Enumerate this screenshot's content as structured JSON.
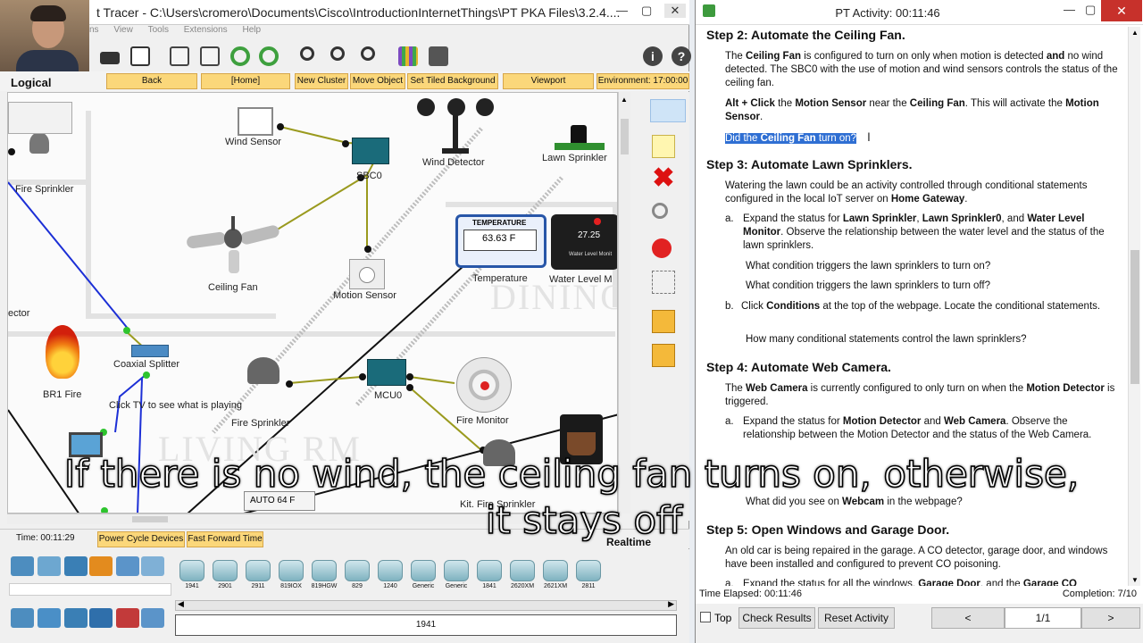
{
  "pt_window": {
    "title": "Cisco Packet Tracer - C:\\Users\\cromero\\Documents\\Cisco\\IntroductionInternetThings\\PT PKA Files\\3.2.4....",
    "title_visible": "t Tracer - C:\\Users\\cromero\\Documents\\Cisco\\IntroductionInternetThings\\PT PKA Files\\3.2.4....",
    "menu": [
      "ns",
      "View",
      "Tools",
      "Extensions",
      "Help"
    ],
    "nav": {
      "logical": "Logical",
      "back": "Back",
      "home": "[Home]",
      "new_cluster": "New Cluster",
      "move_object": "Move Object",
      "set_tiled_bg": "Set Tiled Background",
      "viewport": "Viewport",
      "environment": "Environment: 17:00:00"
    },
    "canvas_labels": {
      "wind_sensor": "Wind Sensor",
      "sbc0": "SBC0",
      "wind_detector": "Wind Detector",
      "lawn_sprinkler": "Lawn Sprinkler",
      "fire_sprinkler_left": "Fire Sprinkler",
      "ceiling_fan": "Ceiling Fan",
      "motion_sensor": "Motion Sensor",
      "temperature": "Temperature",
      "temperature_title": "TEMPERATURE",
      "temperature_value": "63.63 F",
      "water_level": "Water Level M",
      "water_level_value": "27.25",
      "water_level_inner": "Water Level Monit",
      "dining": "DINING",
      "ector": "ector",
      "br1_fire": "BR1 Fire",
      "coaxial_splitter": "Coaxial Splitter",
      "tv_hint": "Click TV to see what is playing",
      "fire_sprinkler_mid": "Fire Sprinkler",
      "mcu0": "MCU0",
      "fire_monitor": "Fire Monitor",
      "living_rm": "LIVING RM",
      "thermostat": "AUTO  64 F",
      "kit_fire_sprinkler": "Kit. Fire Sprinkler",
      "tv_label": "TV"
    },
    "bottom": {
      "time": "Time: 00:11:29",
      "power_cycle": "Power Cycle Devices",
      "fast_forward": "Fast Forward Time",
      "realtime": "Realtime"
    },
    "device_models": [
      "1941",
      "2901",
      "2911",
      "819IOX",
      "819HGW",
      "829",
      "1240",
      "Generic",
      "Generic",
      "1841",
      "2620XM",
      "2621XM",
      "2811"
    ],
    "selected_device": "1941"
  },
  "activity": {
    "title": "PT Activity: 00:11:46",
    "step2_heading": "Step 2: Automate the Ceiling Fan.",
    "step2_p1_a": "The ",
    "step2_p1_b": "Ceiling Fan",
    "step2_p1_c": " is configured to turn on only when motion is detected ",
    "step2_p1_d": "and",
    "step2_p1_e": " no wind detected. The SBC0 with the use of motion and wind sensors controls the status of the ceiling fan.",
    "step2_p2_a": "Alt + Click",
    "step2_p2_b": " the ",
    "step2_p2_c": "Motion Sensor",
    "step2_p2_d": " near the ",
    "step2_p2_e": "Ceiling Fan",
    "step2_p2_f": ". This will activate the ",
    "step2_p2_g": "Motion Sensor",
    "step2_p2_h": ".",
    "step2_q_a": "Did the ",
    "step2_q_b": "Ceiling Fan",
    "step2_q_c": " turn on?",
    "step3_heading": "Step 3: Automate Lawn Sprinklers.",
    "step3_p1_a": "Watering the lawn could be an activity controlled through conditional statements configured in the local IoT server on ",
    "step3_p1_b": "Home Gateway",
    "step3_p1_c": ".",
    "step3_a_mark": "a.",
    "step3_a_1": "Expand the status for ",
    "step3_a_2": "Lawn Sprinkler",
    "step3_a_3": ", ",
    "step3_a_4": "Lawn Sprinkler0",
    "step3_a_5": ", and ",
    "step3_a_6": "Water Level Monitor",
    "step3_a_7": ". Observe the relationship between the water level and the status of the lawn sprinklers.",
    "step3_q1": "What condition triggers the lawn sprinklers to turn on?",
    "step3_q2": "What condition triggers the lawn sprinklers to turn off?",
    "step3_b_mark": "b.",
    "step3_b_1": "Click ",
    "step3_b_2": "Conditions",
    "step3_b_3": " at the top of the webpage. Locate the conditional statements.",
    "step3_q3": "How many conditional statements control the lawn sprinklers?",
    "step4_heading": "Step 4: Automate Web Camera.",
    "step4_p1_a": "The ",
    "step4_p1_b": "Web Camera",
    "step4_p1_c": " is currently configured to only turn on when the ",
    "step4_p1_d": "Motion Detector",
    "step4_p1_e": " is triggered.",
    "step4_a_mark": "a.",
    "step4_a_1": "Expand the status for ",
    "step4_a_2": "Motion Detector",
    "step4_a_3": " and ",
    "step4_a_4": "Web Camera",
    "step4_a_5": ". Observe the relationship between the Motion Detector and the status of the Web Camera.",
    "step4_q1_a": "What did you see on ",
    "step4_q1_b": "Webcam",
    "step4_q1_c": " in the webpage?",
    "step5_heading": "Step 5: Open Windows and Garage Door.",
    "step5_p1": "An old car is being repaired in the garage. A CO detector, garage door, and windows have been installed and configured to prevent CO poisoning.",
    "step5_a_mark": "a.",
    "step5_a_1": "Expand the status for all the windows, ",
    "step5_a_2": "Garage Door",
    "step5_a_3": ", and the ",
    "step5_a_4": "Garage CO",
    "time_elapsed": "Time Elapsed: 00:11:46",
    "completion": "Completion: 7/10",
    "top_label": "Top",
    "check_results": "Check Results",
    "reset_activity": "Reset Activity",
    "prev": "<",
    "page": "1/1",
    "next": ">"
  },
  "subtitles": {
    "line1": "If there is no wind, the ceiling fan turns on, otherwise,",
    "line2": "it stays off"
  }
}
